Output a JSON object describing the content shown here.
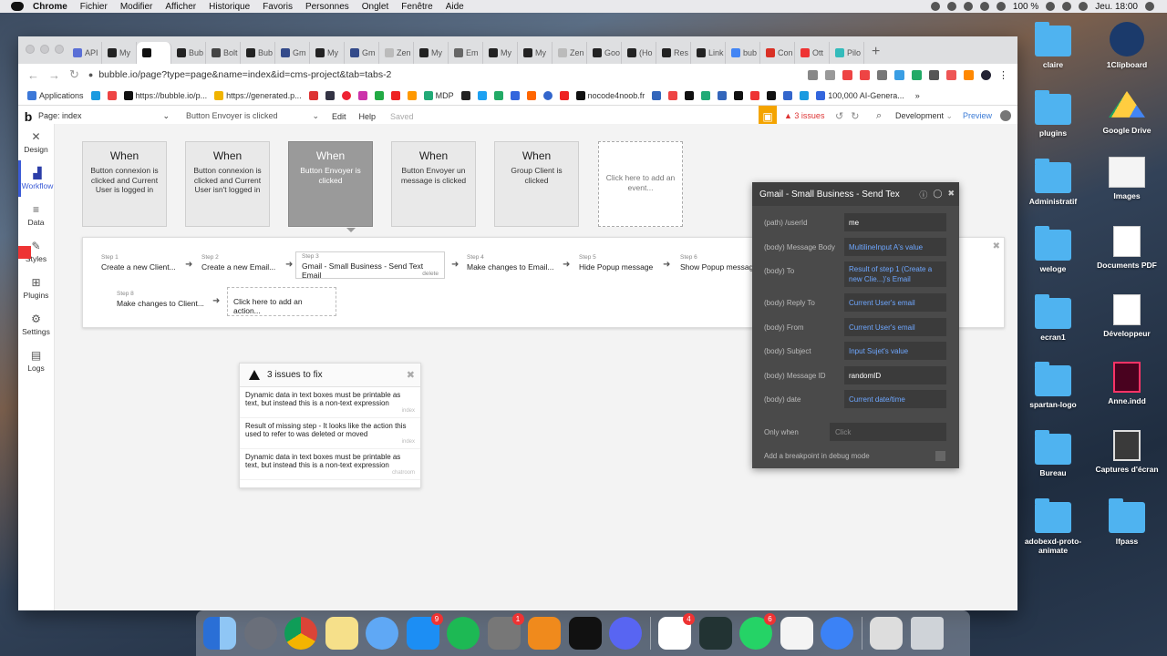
{
  "menubar": {
    "app": "Chrome",
    "items": [
      "Fichier",
      "Modifier",
      "Afficher",
      "Historique",
      "Favoris",
      "Personnes",
      "Onglet",
      "Fenêtre",
      "Aide"
    ],
    "battery": "100 %",
    "clock": "Jeu. 18:00"
  },
  "browser": {
    "tabs": [
      "API",
      "My",
      "",
      "Bub",
      "Bolt",
      "Bub",
      "Gm",
      "My",
      "Gm",
      "Zen",
      "My",
      "Em",
      "My",
      "My",
      "Zen",
      "Goo",
      "(Ho",
      "Res",
      "Link",
      "bub",
      "Con",
      "Ott",
      "Pilo"
    ],
    "url": "bubble.io/page?type=page&name=index&id=cms-project&tab=tabs-2",
    "bookmarks": [
      "Applications",
      "https://bubble.io/p...",
      "https://generated.p...",
      "MDP",
      "nocode4noob.fr",
      "100,000 AI-Genera..."
    ]
  },
  "editor": {
    "page_label": "Page: index",
    "event_selector": "Button Envoyer is clicked",
    "edit": "Edit",
    "help": "Help",
    "saved": "Saved",
    "issues": "3 issues",
    "environment": "Development",
    "preview": "Preview"
  },
  "sidebar": {
    "items": [
      {
        "label": "Design",
        "icon": "design-icon"
      },
      {
        "label": "Workflow",
        "icon": "workflow-icon"
      },
      {
        "label": "Data",
        "icon": "data-icon"
      },
      {
        "label": "Styles",
        "icon": "styles-icon"
      },
      {
        "label": "Plugins",
        "icon": "plugins-icon"
      },
      {
        "label": "Settings",
        "icon": "settings-icon"
      },
      {
        "label": "Logs",
        "icon": "logs-icon"
      }
    ]
  },
  "events": [
    {
      "when": "When",
      "desc": "Button connexion is clicked and Current User is logged in"
    },
    {
      "when": "When",
      "desc": "Button connexion is clicked and Current User isn't logged in"
    },
    {
      "when": "When",
      "desc": "Button Envoyer is clicked"
    },
    {
      "when": "When",
      "desc": "Button Envoyer un message is clicked"
    },
    {
      "when": "When",
      "desc": "Group Client is clicked"
    },
    {
      "when": "",
      "desc": "Click here to add an event..."
    }
  ],
  "steps": [
    {
      "num": "Step 1",
      "label": "Create a new Client..."
    },
    {
      "num": "Step 2",
      "label": "Create a new Email..."
    },
    {
      "num": "Step 3",
      "label": "Gmail - Small Business - Send Text Email",
      "extra": "delete"
    },
    {
      "num": "Step 4",
      "label": "Make changes to Email..."
    },
    {
      "num": "Step 5",
      "label": "Hide Popup message"
    },
    {
      "num": "Step 6",
      "label": "Show Popup message"
    },
    {
      "num": "Step 8",
      "label": "Make changes to Client..."
    }
  ],
  "add_action": "Click here to add an action...",
  "issues_panel": {
    "title": "3 issues to fix",
    "items": [
      {
        "text": "Dynamic data in text boxes must be printable as text, but instead this is a non-text expression",
        "page": "index"
      },
      {
        "text": "Result of missing step - It looks like the action this used to refer to was deleted or moved",
        "page": "index"
      },
      {
        "text": "Dynamic data in text boxes must be printable as text, but instead this is a non-text expression",
        "page": "chatroom"
      }
    ]
  },
  "property_editor": {
    "title": "Gmail - Small Business - Send Tex",
    "rows": [
      {
        "label": "(path) /userId",
        "value": "me"
      },
      {
        "label": "(body) Message Body",
        "value": "MultilineInput A's value"
      },
      {
        "label": "(body) To",
        "value": "Result of step 1 (Create a new Clie...)'s Email"
      },
      {
        "label": "(body) Reply To",
        "value": "Current User's email"
      },
      {
        "label": "(body) From",
        "value": "Current User's email"
      },
      {
        "label": "(body) Subject",
        "value": "Input Sujet's value"
      },
      {
        "label": "(body) Message ID",
        "value": "randomID"
      },
      {
        "label": "(body) date",
        "value": "Current date/time"
      }
    ],
    "only_when_label": "Only when",
    "only_when_placeholder": "Click",
    "breakpoint": "Add a breakpoint in debug mode"
  },
  "desktop": [
    {
      "label": "claire",
      "type": "folder"
    },
    {
      "label": "1Clipboard",
      "type": "app"
    },
    {
      "label": "plugins",
      "type": "folder"
    },
    {
      "label": "Google Drive",
      "type": "app"
    },
    {
      "label": "Administratif",
      "type": "folder"
    },
    {
      "label": "Images",
      "type": "file"
    },
    {
      "label": "weloge",
      "type": "folder"
    },
    {
      "label": "Documents PDF",
      "type": "file"
    },
    {
      "label": "ecran1",
      "type": "folder"
    },
    {
      "label": "Développeur",
      "type": "file"
    },
    {
      "label": "spartan-logo",
      "type": "folder"
    },
    {
      "label": "Anne.indd",
      "type": "file"
    },
    {
      "label": "Bureau",
      "type": "folder"
    },
    {
      "label": "Captures d'écran",
      "type": "file"
    },
    {
      "label": "adobexd-proto-animate",
      "type": "folder"
    },
    {
      "label": "lfpass",
      "type": "folder"
    }
  ],
  "dock_badges": {
    "appstore": "9",
    "sysprefs": "1",
    "slack": "4",
    "whatsapp": "6"
  }
}
